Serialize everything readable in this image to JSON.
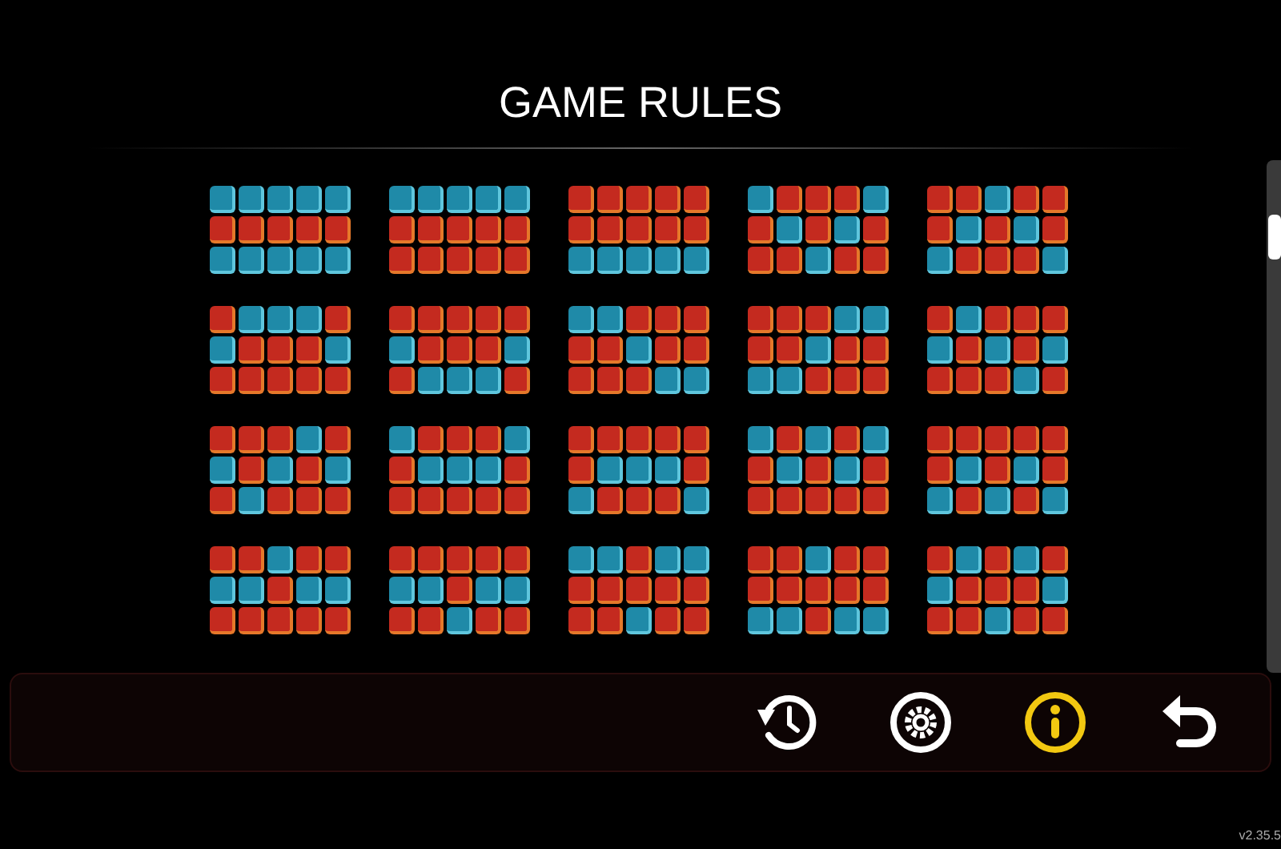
{
  "title": "GAME RULES",
  "paylines": [
    {
      "rows": [
        [
          true,
          true,
          true,
          true,
          true
        ],
        [
          false,
          false,
          false,
          false,
          false
        ],
        [
          true,
          true,
          true,
          true,
          true
        ]
      ]
    },
    {
      "rows": [
        [
          true,
          true,
          true,
          true,
          true
        ],
        [
          false,
          false,
          false,
          false,
          false
        ],
        [
          false,
          false,
          false,
          false,
          false
        ]
      ]
    },
    {
      "rows": [
        [
          false,
          false,
          false,
          false,
          false
        ],
        [
          false,
          false,
          false,
          false,
          false
        ],
        [
          true,
          true,
          true,
          true,
          true
        ]
      ]
    },
    {
      "rows": [
        [
          true,
          false,
          false,
          false,
          true
        ],
        [
          false,
          true,
          false,
          true,
          false
        ],
        [
          false,
          false,
          true,
          false,
          false
        ]
      ]
    },
    {
      "rows": [
        [
          false,
          false,
          true,
          false,
          false
        ],
        [
          false,
          true,
          false,
          true,
          false
        ],
        [
          true,
          false,
          false,
          false,
          true
        ]
      ]
    },
    {
      "rows": [
        [
          false,
          true,
          true,
          true,
          false
        ],
        [
          true,
          false,
          false,
          false,
          true
        ],
        [
          false,
          false,
          false,
          false,
          false
        ]
      ]
    },
    {
      "rows": [
        [
          false,
          false,
          false,
          false,
          false
        ],
        [
          true,
          false,
          false,
          false,
          true
        ],
        [
          false,
          true,
          true,
          true,
          false
        ]
      ]
    },
    {
      "rows": [
        [
          true,
          true,
          false,
          false,
          false
        ],
        [
          false,
          false,
          true,
          false,
          false
        ],
        [
          false,
          false,
          false,
          true,
          true
        ]
      ]
    },
    {
      "rows": [
        [
          false,
          false,
          false,
          true,
          true
        ],
        [
          false,
          false,
          true,
          false,
          false
        ],
        [
          true,
          true,
          false,
          false,
          false
        ]
      ]
    },
    {
      "rows": [
        [
          false,
          true,
          false,
          false,
          false
        ],
        [
          true,
          false,
          true,
          false,
          true
        ],
        [
          false,
          false,
          false,
          true,
          false
        ]
      ]
    },
    {
      "rows": [
        [
          false,
          false,
          false,
          true,
          false
        ],
        [
          true,
          false,
          true,
          false,
          true
        ],
        [
          false,
          true,
          false,
          false,
          false
        ]
      ]
    },
    {
      "rows": [
        [
          true,
          false,
          false,
          false,
          true
        ],
        [
          false,
          true,
          true,
          true,
          false
        ],
        [
          false,
          false,
          false,
          false,
          false
        ]
      ]
    },
    {
      "rows": [
        [
          false,
          false,
          false,
          false,
          false
        ],
        [
          false,
          true,
          true,
          true,
          false
        ],
        [
          true,
          false,
          false,
          false,
          true
        ]
      ]
    },
    {
      "rows": [
        [
          true,
          false,
          true,
          false,
          true
        ],
        [
          false,
          true,
          false,
          true,
          false
        ],
        [
          false,
          false,
          false,
          false,
          false
        ]
      ]
    },
    {
      "rows": [
        [
          false,
          false,
          false,
          false,
          false
        ],
        [
          false,
          true,
          false,
          true,
          false
        ],
        [
          true,
          false,
          true,
          false,
          true
        ]
      ]
    },
    {
      "rows": [
        [
          false,
          false,
          true,
          false,
          false
        ],
        [
          true,
          true,
          false,
          true,
          true
        ],
        [
          false,
          false,
          false,
          false,
          false
        ]
      ]
    },
    {
      "rows": [
        [
          false,
          false,
          false,
          false,
          false
        ],
        [
          true,
          true,
          false,
          true,
          true
        ],
        [
          false,
          false,
          true,
          false,
          false
        ]
      ]
    },
    {
      "rows": [
        [
          true,
          true,
          false,
          true,
          true
        ],
        [
          false,
          false,
          false,
          false,
          false
        ],
        [
          false,
          false,
          true,
          false,
          false
        ]
      ]
    },
    {
      "rows": [
        [
          false,
          false,
          true,
          false,
          false
        ],
        [
          false,
          false,
          false,
          false,
          false
        ],
        [
          true,
          true,
          false,
          true,
          true
        ]
      ]
    },
    {
      "rows": [
        [
          false,
          true,
          false,
          true,
          false
        ],
        [
          true,
          false,
          false,
          false,
          true
        ],
        [
          false,
          false,
          true,
          false,
          false
        ]
      ]
    }
  ],
  "toolbar": [
    {
      "kind": "history",
      "selected": false
    },
    {
      "kind": "settings",
      "selected": false
    },
    {
      "kind": "info",
      "selected": true
    },
    {
      "kind": "back",
      "selected": false
    }
  ],
  "version": "v2.35.5"
}
